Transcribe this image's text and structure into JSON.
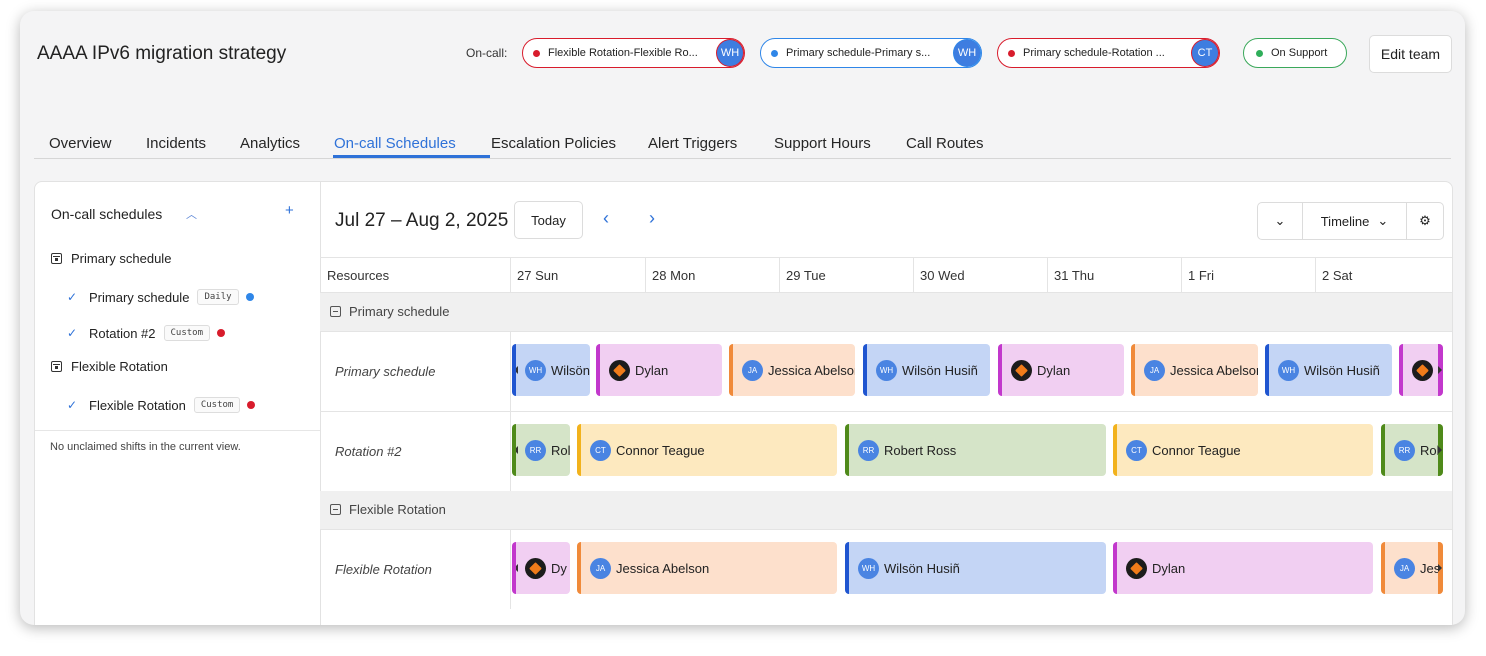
{
  "header": {
    "title": "AAAA IPv6 migration strategy",
    "oncall_label": "On-call:",
    "pills": [
      {
        "text": "Flexible Rotation-Flexible Ro...",
        "initials": "WH",
        "dot_color": "#d81c2c",
        "border_color": "#d81c2c",
        "avatar_color": "#3e7de0"
      },
      {
        "text": "Primary schedule-Primary s...",
        "initials": "WH",
        "dot_color": "#2f86e8",
        "border_color": "#2f86e8",
        "avatar_color": "#3e7de0"
      },
      {
        "text": "Primary schedule-Rotation ...",
        "initials": "CT",
        "dot_color": "#d81c2c",
        "border_color": "#d81c2c",
        "avatar_color": "#3e7de0"
      },
      {
        "text": "On Support",
        "dot_color": "#2fae5a",
        "border_color": "#3aa85a"
      }
    ],
    "edit_team_label": "Edit team"
  },
  "tabs": [
    "Overview",
    "Incidents",
    "Analytics",
    "On-call Schedules",
    "Escalation Policies",
    "Alert Triggers",
    "Support Hours",
    "Call Routes"
  ],
  "active_tab": "On-call Schedules",
  "sidebar": {
    "title": "On-call schedules",
    "collapse_icon": "chevron-up-icon",
    "add_icon": "plus-icon",
    "groups": [
      {
        "name": "Primary schedule",
        "icon": "calendar-icon",
        "items": [
          {
            "name": "Primary schedule",
            "tag": "Daily",
            "dot_color": "#2f86e8",
            "checked": true
          },
          {
            "name": "Rotation #2",
            "tag": "Custom",
            "dot_color": "#d81c2c",
            "checked": true
          }
        ]
      },
      {
        "name": "Flexible Rotation",
        "icon": "calendar-icon",
        "items": [
          {
            "name": "Flexible Rotation",
            "tag": "Custom",
            "dot_color": "#d81c2c",
            "checked": true
          }
        ]
      }
    ],
    "unclaimed_text": "No unclaimed shifts in the current view."
  },
  "calendar": {
    "range": "Jul 27 – Aug 2, 2025",
    "today_label": "Today",
    "view_label": "Timeline",
    "columns_header": "Resources",
    "days": [
      "27 Sun",
      "28 Mon",
      "29 Tue",
      "30 Wed",
      "31 Thu",
      "1 Fri",
      "2 Sat"
    ],
    "sections": [
      {
        "name": "Primary schedule",
        "rows": [
          {
            "label": "Primary schedule",
            "shifts": [
              {
                "person": "Wilsön Husiñ",
                "shown": "Wilsön",
                "initials": "WH",
                "kind": "wh",
                "cont_left": true
              },
              {
                "person": "Dylan",
                "shown": "Dylan",
                "kind": "dy"
              },
              {
                "person": "Jessica Abelson",
                "shown": "Jessica Abelson",
                "initials": "JA",
                "kind": "ja"
              },
              {
                "person": "Wilsön Husiñ",
                "shown": "Wilsön Husiñ",
                "initials": "WH",
                "kind": "wh"
              },
              {
                "person": "Dylan",
                "shown": "Dylan",
                "kind": "dy"
              },
              {
                "person": "Jessica Abelson",
                "shown": "Jessica Abelson",
                "initials": "JA",
                "kind": "ja"
              },
              {
                "person": "Wilsön Husiñ",
                "shown": "Wilsön Husiñ",
                "initials": "WH",
                "kind": "wh"
              },
              {
                "person": "Dylan",
                "shown": "",
                "kind": "dy",
                "cont_right": true
              }
            ]
          },
          {
            "label": "Rotation #2",
            "shifts": [
              {
                "person": "Robert Ross",
                "shown": "Rol",
                "initials": "RR",
                "kind": "rr",
                "cont_left": true
              },
              {
                "person": "Connor Teague",
                "shown": "Connor Teague",
                "initials": "CT",
                "kind": "ct"
              },
              {
                "person": "Robert Ross",
                "shown": "Robert Ross",
                "initials": "RR",
                "kind": "rr"
              },
              {
                "person": "Connor Teague",
                "shown": "Connor Teague",
                "initials": "CT",
                "kind": "ct"
              },
              {
                "person": "Robert Ross",
                "shown": "Rob",
                "initials": "RR",
                "kind": "rr",
                "cont_right": true
              }
            ]
          }
        ]
      },
      {
        "name": "Flexible Rotation",
        "rows": [
          {
            "label": "Flexible Rotation",
            "shifts": [
              {
                "person": "Dylan",
                "shown": "Dy",
                "kind": "dy",
                "cont_left": true
              },
              {
                "person": "Jessica Abelson",
                "shown": "Jessica Abelson",
                "initials": "JA",
                "kind": "ja"
              },
              {
                "person": "Wilsön Husiñ",
                "shown": "Wilsön Husiñ",
                "initials": "WH",
                "kind": "wh"
              },
              {
                "person": "Dylan",
                "shown": "Dylan",
                "kind": "dy"
              },
              {
                "person": "Jessica Abelson",
                "shown": "Jes",
                "initials": "JA",
                "kind": "ja",
                "cont_right": true
              }
            ]
          }
        ]
      }
    ],
    "palette": {
      "wh": {
        "bg": "#c4d5f5",
        "bar": "#1f55d0",
        "avatar": "#4a84e2"
      },
      "dy": {
        "bg": "#f1cff2",
        "bar": "#c238cc",
        "avatar": "#1c1c1c"
      },
      "ja": {
        "bg": "#fde0cc",
        "bar": "#f08a3a",
        "avatar": "#4a84e2"
      },
      "rr": {
        "bg": "#d5e4c8",
        "bar": "#4f8a1a",
        "avatar": "#4a84e2"
      },
      "ct": {
        "bg": "#fde9bf",
        "bar": "#f2b21c",
        "avatar": "#4a84e2"
      }
    }
  }
}
